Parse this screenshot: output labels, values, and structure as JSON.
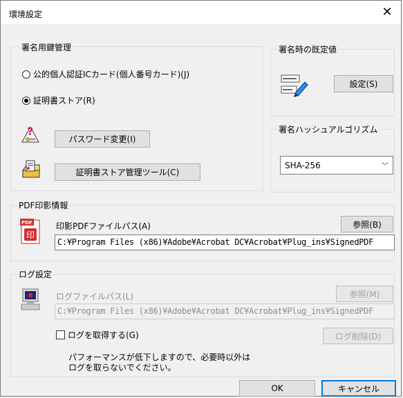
{
  "window": {
    "title": "環境設定",
    "close_glyph": "✕"
  },
  "key_management": {
    "group_label": "署名用鍵管理",
    "radio_ic_card": "公的個人認証ICカード(個人番号カード)(J)",
    "radio_cert_store": "証明書ストア(R)",
    "selected": "cert_store",
    "password_button": "パスワード変更(I)",
    "cert_tool_button": "証明書ストア管理ツール(C)"
  },
  "defaults": {
    "group_label": "署名時の既定値",
    "settings_button": "設定(S)"
  },
  "hash": {
    "group_label": "署名ハッシュアルゴリズム",
    "selected": "SHA-256"
  },
  "pdf": {
    "group_label": "PDF印影情報",
    "path_label": "印影PDFファイルパス(A)",
    "browse_button": "参照(B)",
    "path_value": "C:¥Program Files (x86)¥Adobe¥Acrobat DC¥Acrobat¥Plug_ins¥SignedPDF"
  },
  "log": {
    "group_label": "ログ設定",
    "path_label": "ログファイルパス(L)",
    "browse_button": "参照(M)",
    "path_value": "C:¥Program Files (x86)¥Adobe¥Acrobat DC¥Acrobat¥Plug_ins¥SignedPDF",
    "checkbox_label": "ログを取得する(G)",
    "checked": false,
    "delete_button": "ログ削除(D)",
    "note_line1": "パフォーマンスが低下しますので、必要時以外は",
    "note_line2": "ログを取らないでください。"
  },
  "footer": {
    "ok_button": "OK",
    "cancel_button": "キャンセル"
  }
}
